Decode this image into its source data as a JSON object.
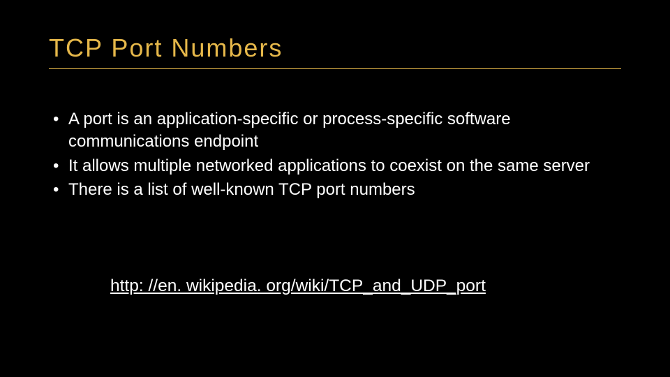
{
  "slide": {
    "title": "TCP Port Numbers",
    "bullets": [
      "A port is an application-specific or process-specific software communications endpoint",
      "It allows multiple networked applications to coexist on the same server",
      "There is a list of well-known TCP port numbers"
    ],
    "link_text": "http: //en. wikipedia. org/wiki/TCP_and_UDP_port"
  }
}
